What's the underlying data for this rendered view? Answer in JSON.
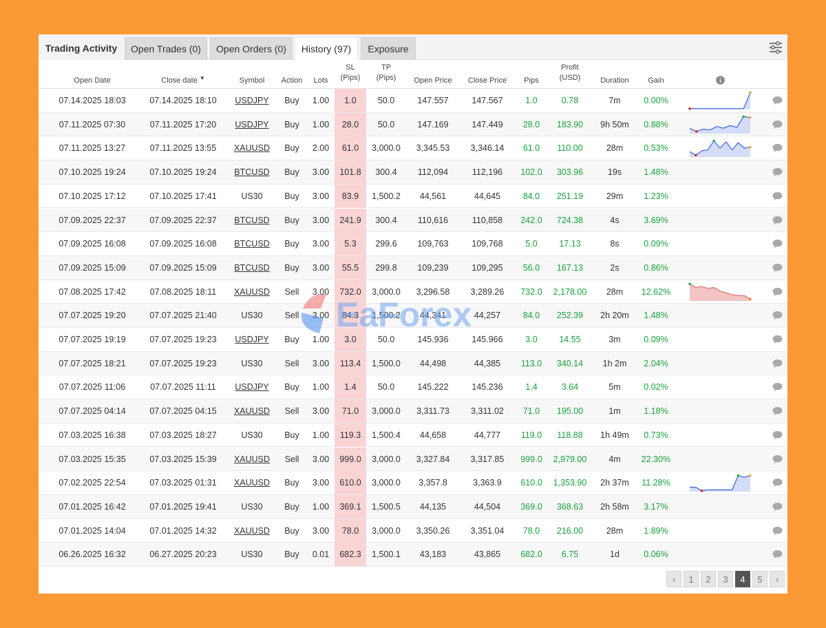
{
  "tabs": {
    "title": "Trading Activity",
    "items": [
      "Open Trades (0)",
      "Open Orders (0)",
      "History (97)",
      "Exposure"
    ],
    "active_index": 2
  },
  "columns": {
    "open_date": "Open Date",
    "close_date": "Close date",
    "symbol": "Symbol",
    "action": "Action",
    "lots": "Lots",
    "sl": [
      "SL",
      "(Pips)"
    ],
    "tp": [
      "TP",
      "(Pips)"
    ],
    "open_price": "Open Price",
    "close_price": "Close Price",
    "pips": "Pips",
    "profit": [
      "Profit",
      "(USD)"
    ],
    "duration": "Duration",
    "gain": "Gain"
  },
  "rows": [
    {
      "open_date": "07.14.2025 18:03",
      "close_date": "07.14.2025 18:10",
      "symbol": "USDJPY",
      "symbol_link": true,
      "action": "Buy",
      "lots": "1.00",
      "sl": "1.0",
      "tp": "50.0",
      "open_price": "147.557",
      "close_price": "147.567",
      "pips": "1.0",
      "profit": "0.78",
      "duration": "7m",
      "gain": "0.00%",
      "spark": [
        0.05,
        0.05,
        0.05,
        0.05,
        0.05,
        0.05,
        0.05,
        0.05,
        0.05,
        0.95
      ],
      "spark_type": "blue"
    },
    {
      "open_date": "07.11.2025 07:30",
      "close_date": "07.11.2025 17:20",
      "symbol": "USDJPY",
      "symbol_link": true,
      "action": "Buy",
      "lots": "1.00",
      "sl": "28.0",
      "tp": "50.0",
      "open_price": "147.169",
      "close_price": "147.449",
      "pips": "28.0",
      "profit": "183.90",
      "duration": "9h 50m",
      "gain": "0.88%",
      "spark": [
        0.3,
        0.12,
        0.25,
        0.2,
        0.4,
        0.3,
        0.45,
        0.35,
        0.95,
        0.9
      ],
      "spark_type": "blue"
    },
    {
      "open_date": "07.11.2025 13:27",
      "close_date": "07.11.2025 13:55",
      "symbol": "XAUUSD",
      "symbol_link": true,
      "action": "Buy",
      "lots": "2.00",
      "sl": "61.0",
      "tp": "3,000.0",
      "open_price": "3,345.53",
      "close_price": "3,346.14",
      "pips": "61.0",
      "profit": "110.00",
      "duration": "28m",
      "gain": "0.53%",
      "spark": [
        0.3,
        0.1,
        0.35,
        0.4,
        0.9,
        0.5,
        0.85,
        0.4,
        0.8,
        0.5,
        0.55
      ],
      "spark_type": "blue"
    },
    {
      "open_date": "07.10.2025 19:24",
      "close_date": "07.10.2025 19:24",
      "symbol": "BTCUSD",
      "symbol_link": true,
      "action": "Buy",
      "lots": "3.00",
      "sl": "101.8",
      "tp": "300.4",
      "open_price": "112,094",
      "close_price": "112,196",
      "pips": "102.0",
      "profit": "303.96",
      "duration": "19s",
      "gain": "1.48%"
    },
    {
      "open_date": "07.10.2025 17:12",
      "close_date": "07.10.2025 17:41",
      "symbol": "US30",
      "symbol_link": false,
      "action": "Buy",
      "lots": "3.00",
      "sl": "83.9",
      "tp": "1,500.2",
      "open_price": "44,561",
      "close_price": "44,645",
      "pips": "84.0",
      "profit": "251.19",
      "duration": "29m",
      "gain": "1.23%"
    },
    {
      "open_date": "07.09.2025 22:37",
      "close_date": "07.09.2025 22:37",
      "symbol": "BTCUSD",
      "symbol_link": true,
      "action": "Buy",
      "lots": "3.00",
      "sl": "241.9",
      "tp": "300.4",
      "open_price": "110,616",
      "close_price": "110,858",
      "pips": "242.0",
      "profit": "724.38",
      "duration": "4s",
      "gain": "3.69%"
    },
    {
      "open_date": "07.09.2025 16:08",
      "close_date": "07.09.2025 16:08",
      "symbol": "BTCUSD",
      "symbol_link": true,
      "action": "Buy",
      "lots": "3.00",
      "sl": "5.3",
      "tp": "299.6",
      "open_price": "109,763",
      "close_price": "109,768",
      "pips": "5.0",
      "profit": "17.13",
      "duration": "8s",
      "gain": "0.09%"
    },
    {
      "open_date": "07.09.2025 15:09",
      "close_date": "07.09.2025 15:09",
      "symbol": "BTCUSD",
      "symbol_link": true,
      "action": "Buy",
      "lots": "3.00",
      "sl": "55.5",
      "tp": "299.8",
      "open_price": "109,239",
      "close_price": "109,295",
      "pips": "56.0",
      "profit": "167.13",
      "duration": "2s",
      "gain": "0.86%"
    },
    {
      "open_date": "07.08.2025 17:42",
      "close_date": "07.08.2025 18:11",
      "symbol": "XAUUSD",
      "symbol_link": true,
      "action": "Sell",
      "lots": "3.00",
      "sl": "732.0",
      "tp": "3,000.0",
      "open_price": "3,296.58",
      "close_price": "3,289.26",
      "pips": "732.0",
      "profit": "2,178.00",
      "duration": "28m",
      "gain": "12.62%",
      "spark": [
        0.95,
        0.75,
        0.8,
        0.7,
        0.75,
        0.55,
        0.45,
        0.35,
        0.3,
        0.3,
        0.1
      ],
      "spark_type": "red"
    },
    {
      "open_date": "07.07.2025 19:20",
      "close_date": "07.07.2025 21:40",
      "symbol": "US30",
      "symbol_link": false,
      "action": "Sell",
      "lots": "3.00",
      "sl": "84.3",
      "tp": "1,500.2",
      "open_price": "44,341",
      "close_price": "44,257",
      "pips": "84.0",
      "profit": "252.39",
      "duration": "2h 20m",
      "gain": "1.48%"
    },
    {
      "open_date": "07.07.2025 19:19",
      "close_date": "07.07.2025 19:23",
      "symbol": "USDJPY",
      "symbol_link": true,
      "action": "Buy",
      "lots": "1.00",
      "sl": "3.0",
      "tp": "50.0",
      "open_price": "145.936",
      "close_price": "145.966",
      "pips": "3.0",
      "profit": "14.55",
      "duration": "3m",
      "gain": "0.09%"
    },
    {
      "open_date": "07.07.2025 18:21",
      "close_date": "07.07.2025 19:23",
      "symbol": "US30",
      "symbol_link": false,
      "action": "Sell",
      "lots": "3.00",
      "sl": "113.4",
      "tp": "1,500.0",
      "open_price": "44,498",
      "close_price": "44,385",
      "pips": "113.0",
      "profit": "340.14",
      "duration": "1h 2m",
      "gain": "2.04%"
    },
    {
      "open_date": "07.07.2025 11:06",
      "close_date": "07.07.2025 11:11",
      "symbol": "USDJPY",
      "symbol_link": true,
      "action": "Buy",
      "lots": "1.00",
      "sl": "1.4",
      "tp": "50.0",
      "open_price": "145.222",
      "close_price": "145.236",
      "pips": "1.4",
      "profit": "3.64",
      "duration": "5m",
      "gain": "0.02%"
    },
    {
      "open_date": "07.07.2025 04:14",
      "close_date": "07.07.2025 04:15",
      "symbol": "XAUUSD",
      "symbol_link": true,
      "action": "Sell",
      "lots": "3.00",
      "sl": "71.0",
      "tp": "3,000.0",
      "open_price": "3,311.73",
      "close_price": "3,311.02",
      "pips": "71.0",
      "profit": "195.00",
      "duration": "1m",
      "gain": "1.18%"
    },
    {
      "open_date": "07.03.2025 16:38",
      "close_date": "07.03.2025 18:27",
      "symbol": "US30",
      "symbol_link": false,
      "action": "Buy",
      "lots": "1.00",
      "sl": "119.3",
      "tp": "1,500.4",
      "open_price": "44,658",
      "close_price": "44,777",
      "pips": "119.0",
      "profit": "118.88",
      "duration": "1h 49m",
      "gain": "0.73%"
    },
    {
      "open_date": "07.03.2025 15:35",
      "close_date": "07.03.2025 15:39",
      "symbol": "XAUUSD",
      "symbol_link": true,
      "action": "Sell",
      "lots": "3.00",
      "sl": "999.0",
      "tp": "3,000.0",
      "open_price": "3,327.84",
      "close_price": "3,317.85",
      "pips": "999.0",
      "profit": "2,979.00",
      "duration": "4m",
      "gain": "22.30%"
    },
    {
      "open_date": "07.02.2025 22:54",
      "close_date": "07.03.2025 01:31",
      "symbol": "XAUUSD",
      "symbol_link": true,
      "action": "Buy",
      "lots": "3.00",
      "sl": "610.0",
      "tp": "3,000.0",
      "open_price": "3,357.8",
      "close_price": "3,363.9",
      "pips": "610.0",
      "profit": "1,353.90",
      "duration": "2h 37m",
      "gain": "11.28%",
      "spark": [
        0.25,
        0.25,
        0.05,
        0.1,
        0.1,
        0.1,
        0.1,
        0.1,
        0.9,
        0.8,
        0.9
      ],
      "spark_type": "blue"
    },
    {
      "open_date": "07.01.2025 16:42",
      "close_date": "07.01.2025 19:41",
      "symbol": "US30",
      "symbol_link": false,
      "action": "Buy",
      "lots": "1.00",
      "sl": "369.1",
      "tp": "1,500.5",
      "open_price": "44,135",
      "close_price": "44,504",
      "pips": "369.0",
      "profit": "368.63",
      "duration": "2h 58m",
      "gain": "3.17%"
    },
    {
      "open_date": "07.01.2025 14:04",
      "close_date": "07.01.2025 14:32",
      "symbol": "XAUUSD",
      "symbol_link": true,
      "action": "Buy",
      "lots": "3.00",
      "sl": "78.0",
      "tp": "3,000.0",
      "open_price": "3,350.26",
      "close_price": "3,351.04",
      "pips": "78.0",
      "profit": "216.00",
      "duration": "28m",
      "gain": "1.89%"
    },
    {
      "open_date": "06.26.2025 16:32",
      "close_date": "06.27.2025 20:23",
      "symbol": "US30",
      "symbol_link": false,
      "action": "Buy",
      "lots": "0.01",
      "sl": "682.3",
      "tp": "1,500.1",
      "open_price": "43,183",
      "close_price": "43,865",
      "pips": "682.0",
      "profit": "6.75",
      "duration": "1d",
      "gain": "0.06%"
    }
  ],
  "pagination": {
    "prev": "‹",
    "next": "›",
    "pages": [
      "1",
      "2",
      "3",
      "4",
      "5"
    ],
    "current": "4"
  },
  "watermark": "EaForex",
  "colors": {
    "background": "#fb9a34",
    "green": "#18a33a",
    "sl_highlight": "#f8d4d4",
    "spark_blue": "#3d63e6",
    "spark_red": "#e06a6a"
  },
  "icons": {
    "info": "info-icon",
    "comment": "comment-icon",
    "settings": "settings-sliders-icon",
    "sort": "sort-desc-icon"
  }
}
